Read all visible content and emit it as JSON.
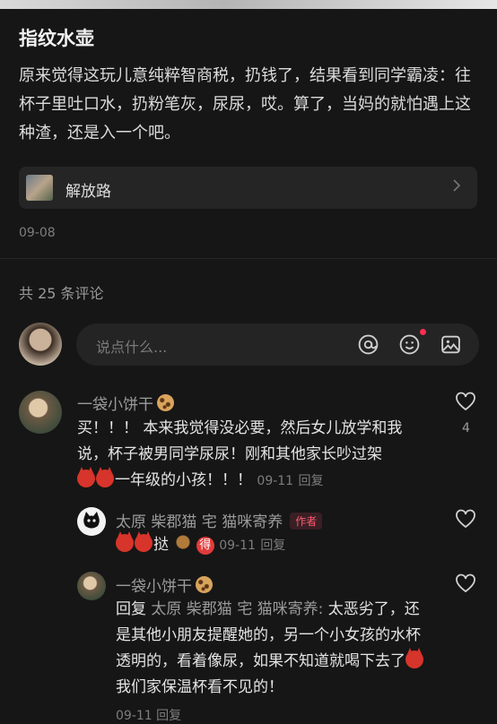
{
  "post": {
    "title": "指纹水壶",
    "body": "原来觉得这玩儿意纯粹智商税，扔钱了，结果看到同学霸凌：往杯子里吐口水，扔粉笔灰，尿尿，哎。算了，当妈的就怕遇上这种渣，还是入一个吧。",
    "location": "解放路",
    "date": "09-08"
  },
  "comments_header": {
    "count_text": "共 25 条评论"
  },
  "input": {
    "placeholder": "说点什么..."
  },
  "icons": {
    "at": "at-icon",
    "emoji": "emoji-icon",
    "image": "image-icon",
    "heart": "heart-outline-icon",
    "chevron": "chevron-right-icon"
  },
  "colors": {
    "background": "#161616",
    "author_badge": "#ff5a6f",
    "notification_dot": "#ff2d55"
  },
  "comments": [
    {
      "username": "一袋小饼干",
      "text_a": "买！！！ 本来我觉得没必要，然后女儿放学和我说，杯子被男同学尿尿！刚和其他家长吵过架",
      "text_b": "一年级的小孩！！！",
      "date": "09-11",
      "reply_label": "回复",
      "likes": "4"
    },
    {
      "username": "太原 柴郡猫 宅 猫咪寄养",
      "author_badge": "作者",
      "text": "挞",
      "de": "得",
      "date": "09-11",
      "reply_label": "回复"
    },
    {
      "username": "一袋小饼干",
      "reply_prefix": "回复",
      "reply_to": "太原 柴郡猫 宅 猫咪寄养:",
      "text_a": "太恶劣了，还是其他小朋友提醒她的，另一个小女孩的水杯透明的，看着像尿，如果不知道就喝下去了",
      "text_b": "我们家保温杯看不见的！",
      "date": "09-11",
      "reply_label": "回复"
    }
  ]
}
